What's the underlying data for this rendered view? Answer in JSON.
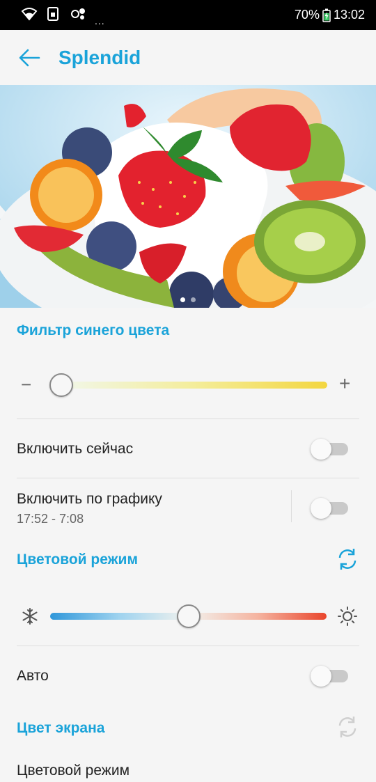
{
  "status_bar": {
    "battery_percent": "70%",
    "time": "13:02",
    "icons": [
      "wifi-icon",
      "sim-icon",
      "bluetooth-icon"
    ],
    "more": "..."
  },
  "app_bar": {
    "title": "Splendid",
    "back_icon": "arrow-left-icon"
  },
  "preview": {
    "image": "fruit-salad-photo",
    "pages": 2,
    "current_page": 1
  },
  "blue_filter": {
    "title": "Фильтр синего цвета",
    "minus": "−",
    "plus": "+",
    "level": 0.0
  },
  "enable_now": {
    "label": "Включить сейчас",
    "on": false
  },
  "schedule": {
    "label": "Включить по графику",
    "time_range": "17:52 - 7:08",
    "on": false
  },
  "color_mode": {
    "title": "Цветовой режим",
    "reset_icon": "refresh-icon",
    "cold_icon": "snowflake-icon",
    "warm_icon": "sun-icon",
    "level": 0.5
  },
  "auto": {
    "label": "Авто",
    "on": false
  },
  "screen_color": {
    "title": "Цвет экрана",
    "reset_icon": "refresh-icon"
  },
  "next_item": {
    "label": "Цветовой режим"
  },
  "colors": {
    "accent": "#1aa3d9"
  }
}
